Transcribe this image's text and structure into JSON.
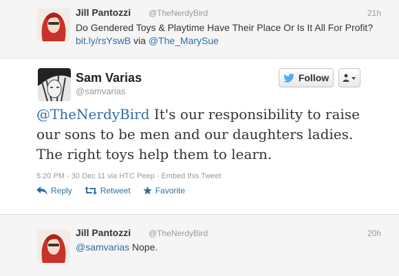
{
  "tweet_top": {
    "name": "Jill Pantozzi",
    "handle": "@TheNerdyBird",
    "time": "21h",
    "text": "Do Gendered Toys & Playtime Have Their Place Or Is It All For Profit?",
    "link": "bit.ly/rsYswB",
    "via_word": "via",
    "via_handle": "@The_MarySue"
  },
  "main_tweet": {
    "name": "Sam Varias",
    "handle": "@samvarias",
    "mention": "@TheNerdyBird",
    "text": " It's our responsibility to raise our sons to be men and our daughters ladies. The right toys help them to learn.",
    "meta": "5:20 PM - 30 Dec 11 via HTC Peep · Embed this Tweet",
    "follow_label": "Follow",
    "actions": {
      "reply": "Reply",
      "retweet": "Retweet",
      "favorite": "Favorite"
    }
  },
  "tweet_bottom": {
    "name": "Jill Pantozzi",
    "handle": "@TheNerdyBird",
    "time": "20h",
    "mention": "@samvarias",
    "text": " Nope."
  },
  "colors": {
    "link": "#2f6ea8",
    "twitter_bird": "#55acee",
    "muted": "#999999"
  }
}
